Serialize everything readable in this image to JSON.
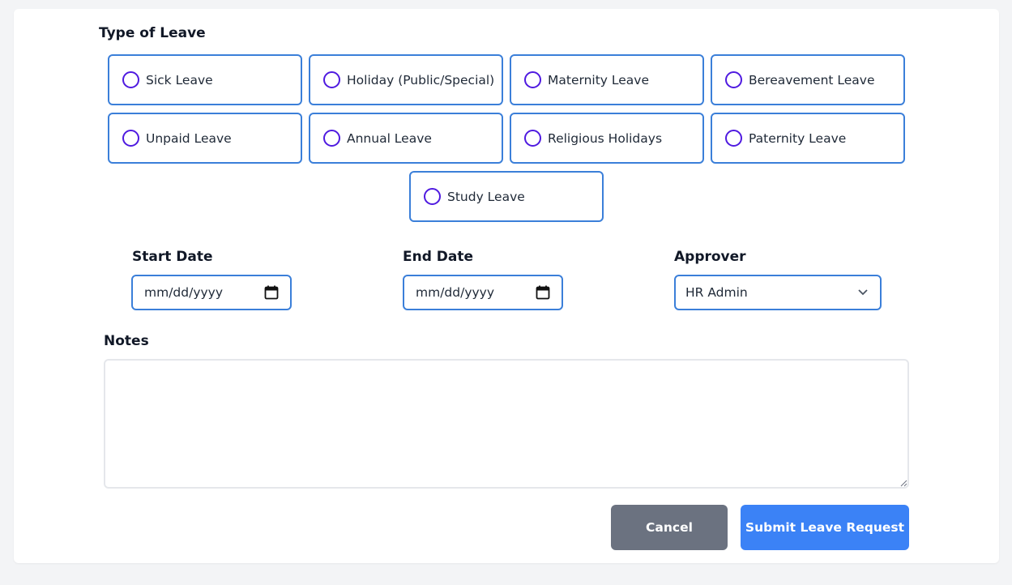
{
  "form": {
    "type_of_leave_label": "Type of Leave",
    "leave_types": [
      "Sick Leave",
      "Holiday (Public/Special)",
      "Maternity Leave",
      "Bereavement Leave",
      "Unpaid Leave",
      "Annual Leave",
      "Religious Holidays",
      "Paternity Leave",
      "Study Leave"
    ],
    "start_date": {
      "label": "Start Date",
      "placeholder": "mm/dd/yyyy"
    },
    "end_date": {
      "label": "End Date",
      "placeholder": "mm/dd/yyyy"
    },
    "approver": {
      "label": "Approver",
      "value": "HR Admin"
    },
    "notes": {
      "label": "Notes",
      "value": ""
    },
    "buttons": {
      "cancel": "Cancel",
      "submit": "Submit Leave Request"
    }
  },
  "colors": {
    "border_accent": "#3b7fd9",
    "radio": "#4f1ae0",
    "cancel_bg": "#6b7280",
    "submit_bg": "#3b82f6"
  }
}
